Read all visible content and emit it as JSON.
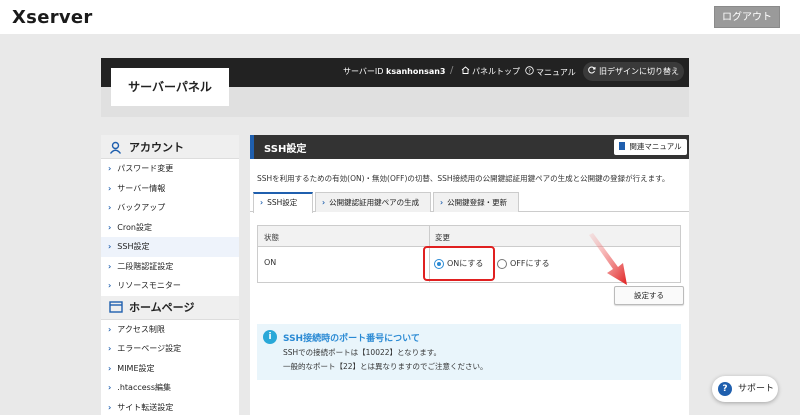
{
  "topbar": {
    "logo": "Xserver",
    "logout_label": "ログアウト"
  },
  "header": {
    "panel_name": "サーバーパネル",
    "server_id_label": "サーバーID",
    "server_id": "ksanhonsan3",
    "panel_top_label": "パネルトップ",
    "manual_label": "マニュアル",
    "old_design_label": "旧デザインに切り替え"
  },
  "sidebar": {
    "sections": [
      {
        "title": "アカウント",
        "items": [
          "パスワード変更",
          "サーバー情報",
          "バックアップ",
          "Cron設定",
          "SSH設定",
          "二段階認証設定",
          "リソースモニター"
        ]
      },
      {
        "title": "ホームページ",
        "items": [
          "アクセス制限",
          "エラーページ設定",
          "MIME設定",
          ".htaccess編集",
          "サイト転送設定"
        ]
      }
    ],
    "active_item": "SSH設定"
  },
  "main": {
    "title": "SSH設定",
    "manual_button": "関連マニュアル",
    "description": "SSHを利用するための有効(ON)・無効(OFF)の切替、SSH接続用の公開鍵認証用鍵ペアの生成と公開鍵の登録が行えます。",
    "tabs": [
      "SSH設定",
      "公開鍵認証用鍵ペアの生成",
      "公開鍵登録・更新"
    ],
    "table": {
      "headers": [
        "状態",
        "変更"
      ],
      "status": "ON",
      "options": [
        "ONにする",
        "OFFにする"
      ],
      "selected": "ONにする"
    },
    "save_button": "設定する",
    "info": {
      "title": "SSH接続時のポート番号について",
      "lines": [
        "SSHでの接続ポートは【10022】となります。",
        "一般的なポート【22】とは異なりますのでご注意ください。"
      ]
    }
  },
  "support_label": "サポート",
  "colors": {
    "accent": "#1f5fae",
    "highlight": "#e02020",
    "info_bg": "#e9f5fb"
  }
}
